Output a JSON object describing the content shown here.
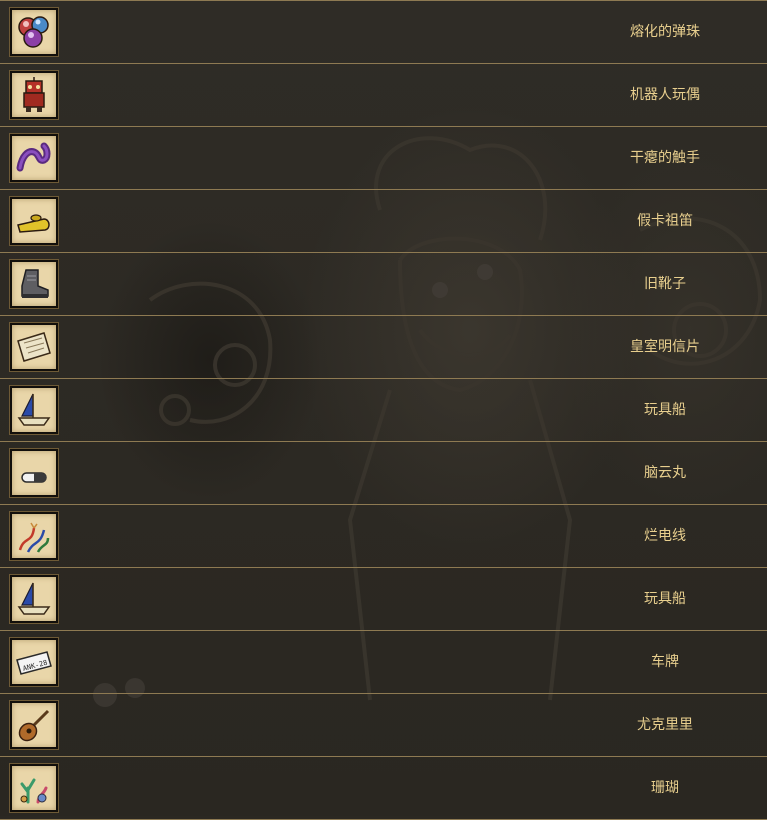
{
  "items": [
    {
      "label": "熔化的弹珠",
      "icon": "melty-marbles-icon"
    },
    {
      "label": "机器人玩偶",
      "icon": "robot-toy-icon"
    },
    {
      "label": "干瘪的触手",
      "icon": "withered-tentacle-icon"
    },
    {
      "label": "假卡祖笛",
      "icon": "fake-kazoo-icon"
    },
    {
      "label": "旧靴子",
      "icon": "old-boot-icon"
    },
    {
      "label": "皇室明信片",
      "icon": "royal-postcard-icon"
    },
    {
      "label": "玩具船",
      "icon": "toy-boat-icon"
    },
    {
      "label": "脑云丸",
      "icon": "brain-pill-icon"
    },
    {
      "label": "烂电线",
      "icon": "frayed-wires-icon"
    },
    {
      "label": "玩具船",
      "icon": "toy-boat-icon"
    },
    {
      "label": "车牌",
      "icon": "license-plate-icon"
    },
    {
      "label": "尤克里里",
      "icon": "ukulele-icon"
    },
    {
      "label": "珊瑚",
      "icon": "coral-icon"
    }
  ],
  "plate_text": "ANK-28",
  "colors": {
    "label": "#e8cf8e",
    "divider": "#8e7a52",
    "background": "#2b2822",
    "icon_bg": "#e9d6a9"
  }
}
